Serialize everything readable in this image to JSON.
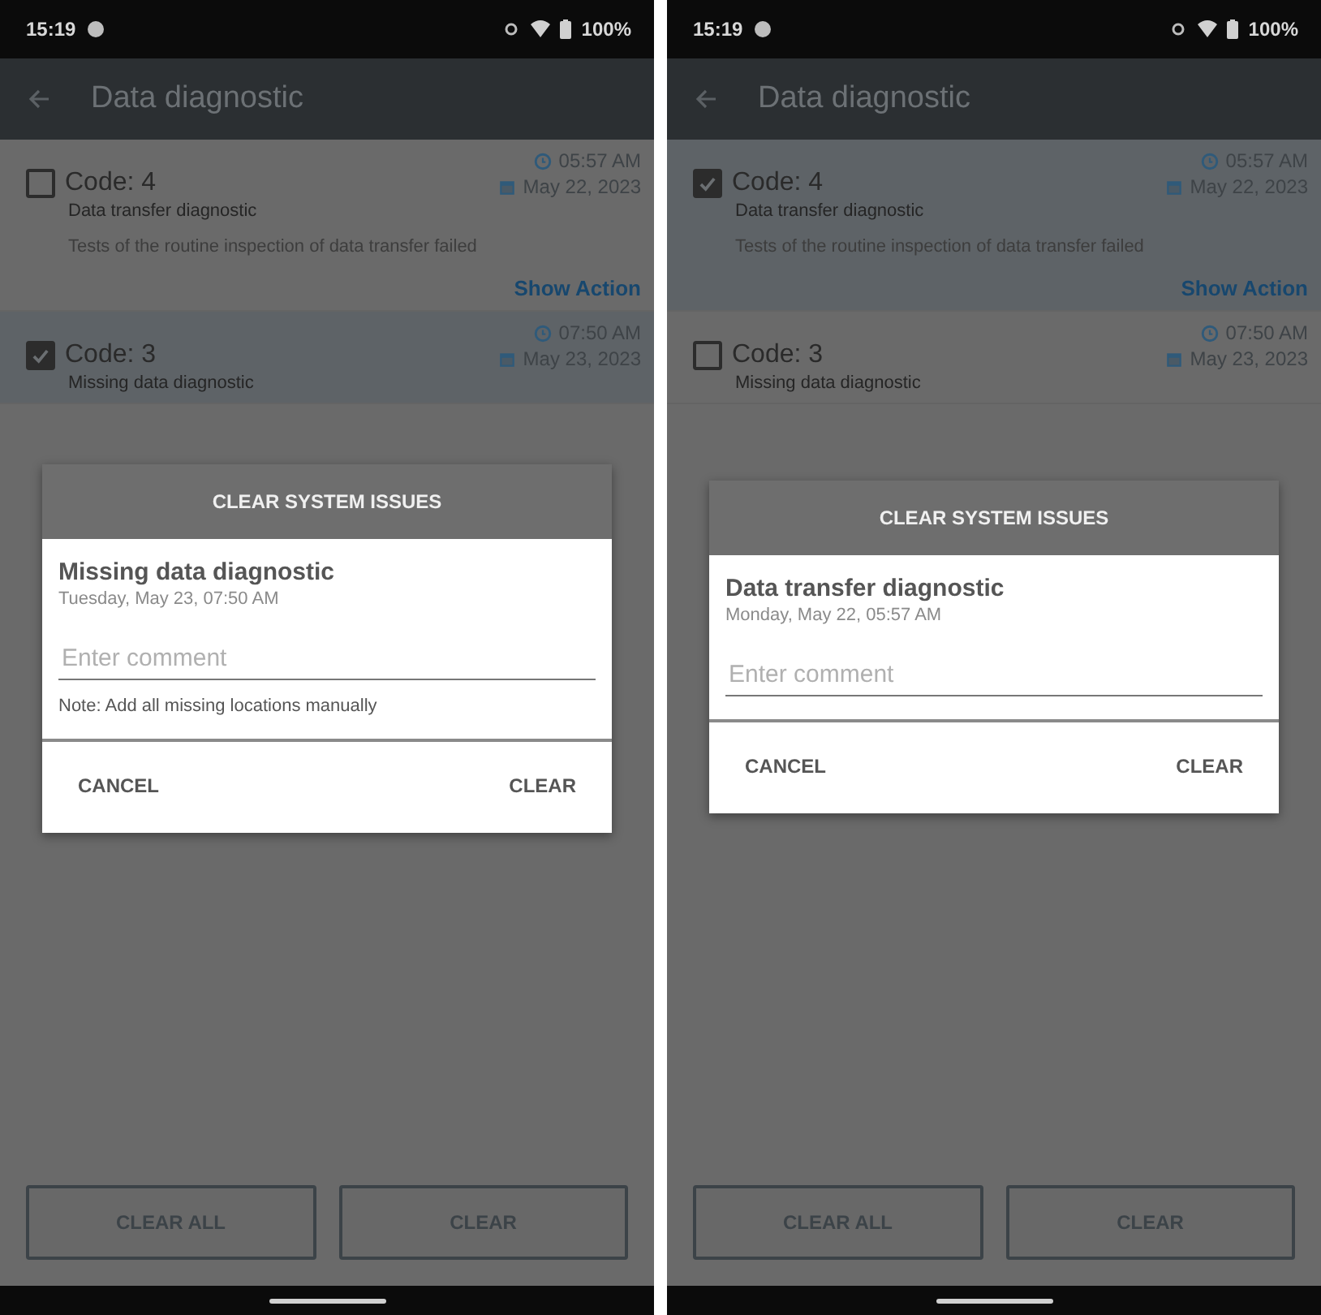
{
  "screens": [
    {
      "status_bar": {
        "time": "15:19",
        "battery": "100%"
      },
      "title": "Data diagnostic",
      "items": [
        {
          "checked": false,
          "code": "Code: 4",
          "name": "Data transfer diagnostic",
          "description": "Tests of the routine inspection of data transfer failed",
          "time": "05:57 AM",
          "date": "May 22, 2023",
          "action": "Show Action"
        },
        {
          "checked": true,
          "code": "Code: 3",
          "name": "Missing data diagnostic",
          "time": "07:50 AM",
          "date": "May 23, 2023"
        }
      ],
      "dialog": {
        "header": "CLEAR SYSTEM ISSUES",
        "title": "Missing data diagnostic",
        "subtitle": "Tuesday, May 23, 07:50 AM",
        "placeholder": "Enter comment",
        "note": "Note: Add all missing locations manually",
        "cancel": "CANCEL",
        "confirm": "CLEAR"
      },
      "buttons": [
        "CLEAR ALL",
        "CLEAR"
      ]
    },
    {
      "status_bar": {
        "time": "15:19",
        "battery": "100%"
      },
      "title": "Data diagnostic",
      "items": [
        {
          "checked": true,
          "code": "Code: 4",
          "name": "Data transfer diagnostic",
          "description": "Tests of the routine inspection of data transfer failed",
          "time": "05:57 AM",
          "date": "May 22, 2023",
          "action": "Show Action"
        },
        {
          "checked": false,
          "code": "Code: 3",
          "name": "Missing data diagnostic",
          "time": "07:50 AM",
          "date": "May 23, 2023"
        }
      ],
      "dialog": {
        "header": "CLEAR SYSTEM ISSUES",
        "title": "Data transfer diagnostic",
        "subtitle": "Monday, May 22, 05:57 AM",
        "placeholder": "Enter comment",
        "cancel": "CANCEL",
        "confirm": "CLEAR"
      },
      "buttons": [
        "CLEAR ALL",
        "CLEAR"
      ]
    }
  ]
}
